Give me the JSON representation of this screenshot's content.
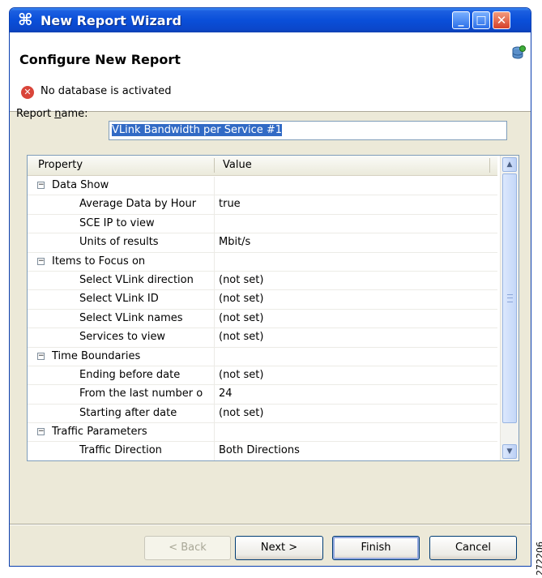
{
  "window": {
    "title": "New Report Wizard"
  },
  "header": {
    "title": "Configure New Report",
    "error_message": "No database is activated"
  },
  "report_name": {
    "label_pre": "Report ",
    "label_mnemonic": "n",
    "label_post": "ame:",
    "value": "VLink Bandwidth per Service #1"
  },
  "table": {
    "columns": [
      "Property",
      "Value"
    ],
    "rows": [
      {
        "type": "group",
        "label": "Data Show",
        "value": ""
      },
      {
        "type": "item",
        "label": "Average Data by Hour",
        "value": "true"
      },
      {
        "type": "item",
        "label": "SCE IP to view",
        "value": ""
      },
      {
        "type": "item",
        "label": "Units of results",
        "value": "Mbit/s"
      },
      {
        "type": "group",
        "label": "Items to Focus on",
        "value": ""
      },
      {
        "type": "item",
        "label": "Select VLink direction",
        "value": "(not set)"
      },
      {
        "type": "item",
        "label": "Select VLink ID",
        "value": "(not set)"
      },
      {
        "type": "item",
        "label": "Select VLink names",
        "value": "(not set)"
      },
      {
        "type": "item",
        "label": "Services to view",
        "value": "(not set)"
      },
      {
        "type": "group",
        "label": "Time Boundaries",
        "value": ""
      },
      {
        "type": "item",
        "label": "Ending before date",
        "value": "(not set)"
      },
      {
        "type": "item",
        "label": "From the last number o",
        "value": "24"
      },
      {
        "type": "item",
        "label": "Starting after date",
        "value": "(not set)"
      },
      {
        "type": "group",
        "label": "Traffic Parameters",
        "value": ""
      },
      {
        "type": "item",
        "label": "Traffic Direction",
        "value": "Both Directions"
      }
    ]
  },
  "buttons": {
    "back": "< Back",
    "next": "Next >",
    "finish": "Finish",
    "cancel": "Cancel"
  },
  "side_id": "272206"
}
